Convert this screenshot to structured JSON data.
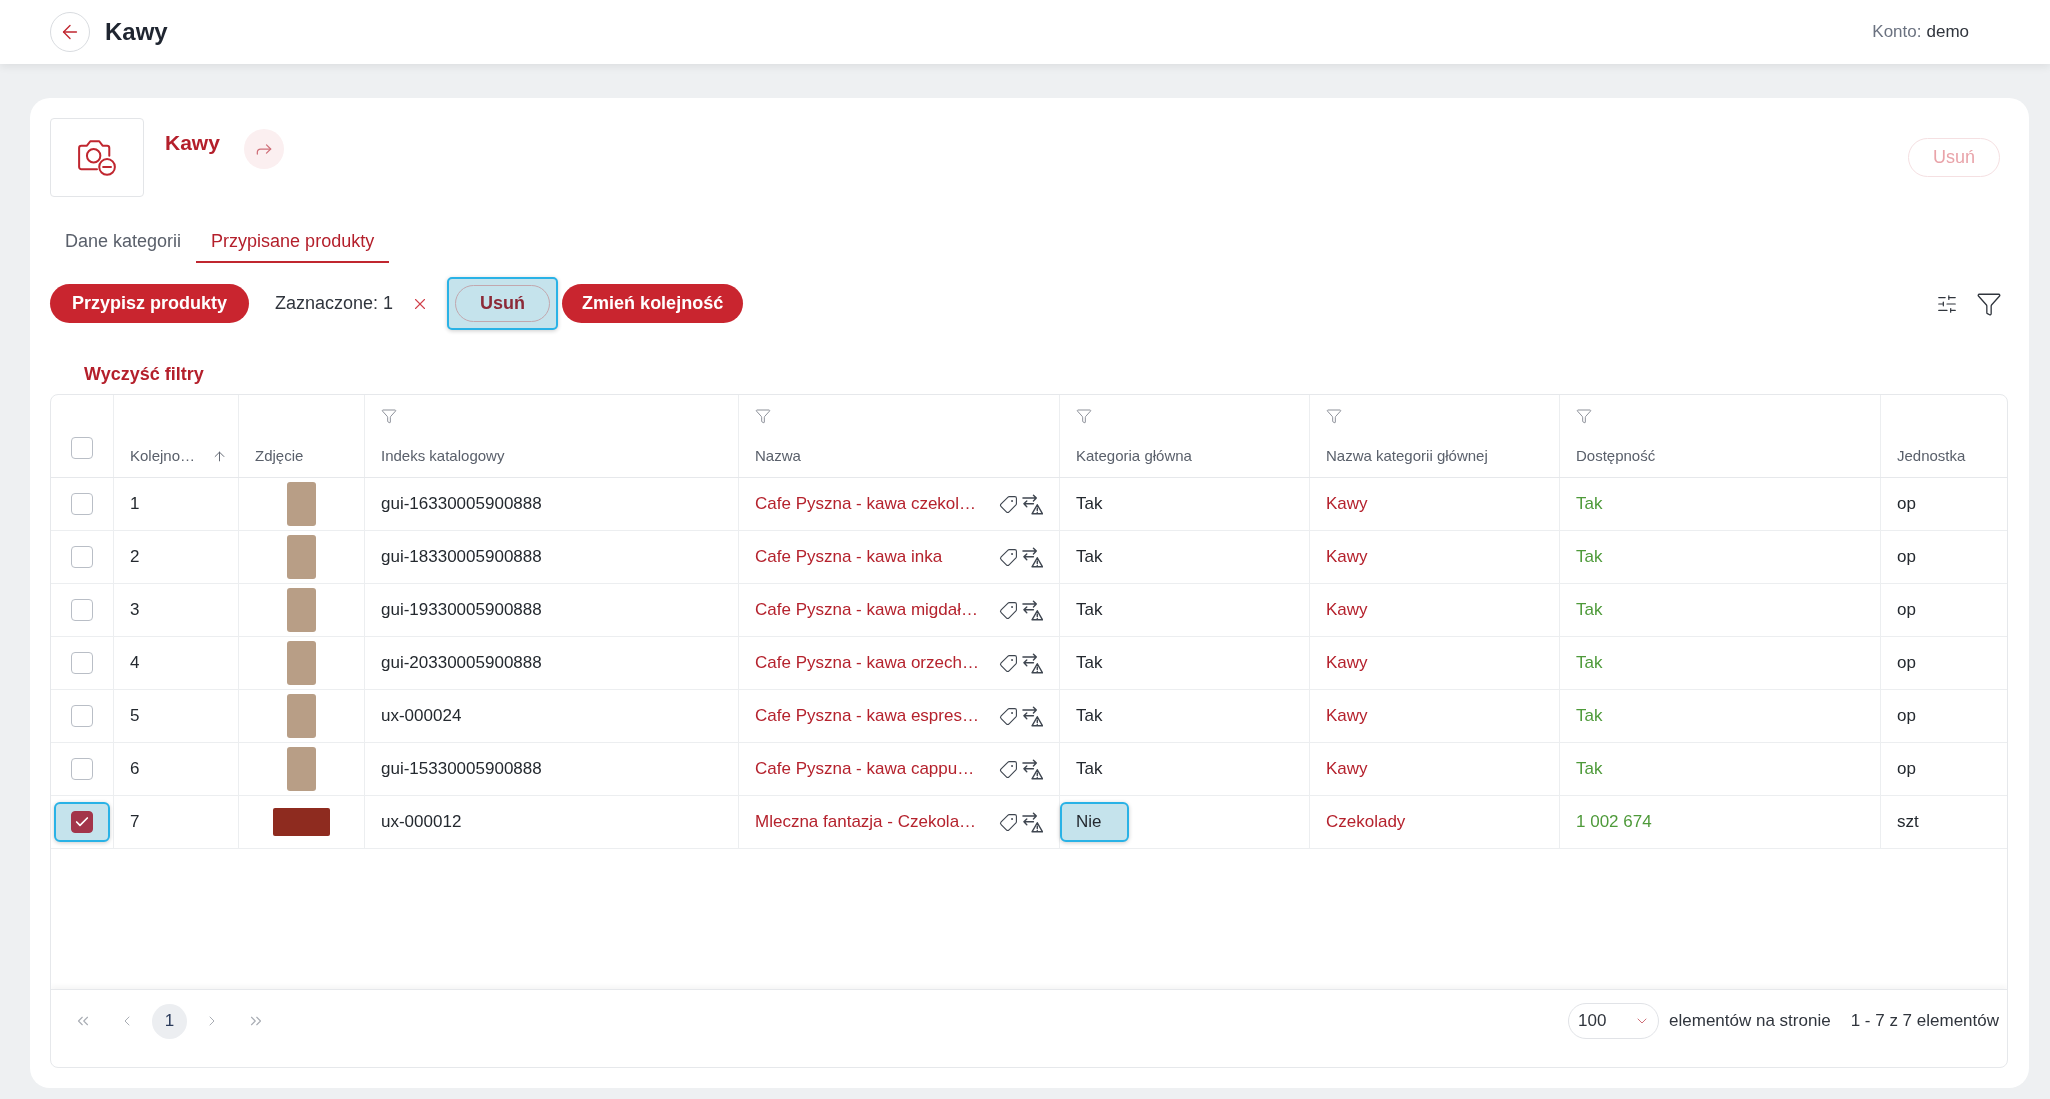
{
  "header": {
    "title": "Kawy",
    "account_label": "Konto:",
    "account_name": "demo"
  },
  "category": {
    "name": "Kawy",
    "delete_label": "Usuń",
    "delete_disabled": true
  },
  "tabs": [
    {
      "label": "Dane kategorii",
      "selected": false
    },
    {
      "label": "Przypisane produkty",
      "selected": true
    }
  ],
  "toolbar": {
    "assign_label": "Przypisz produkty",
    "selection_text": "Zaznaczone: 1",
    "remove_label": "Usuń",
    "remove_highlighted": true,
    "reorder_label": "Zmień kolejność"
  },
  "clear_filters": "Wyczyść filtry",
  "table": {
    "select_all_checked": false,
    "columns": [
      {
        "label": "Kolejno…",
        "filter": false,
        "sorted_ascending": true
      },
      {
        "label": "Zdjęcie",
        "filter": false,
        "sorted_ascending": false
      },
      {
        "label": "Indeks katalogowy",
        "filter": true,
        "sorted_ascending": false
      },
      {
        "label": "Nazwa",
        "filter": true,
        "sorted_ascending": false
      },
      {
        "label": "Kategoria główna",
        "filter": true,
        "sorted_ascending": false
      },
      {
        "label": "Nazwa kategorii głównej",
        "filter": true,
        "sorted_ascending": false
      },
      {
        "label": "Dostępność",
        "filter": true,
        "sorted_ascending": false
      },
      {
        "label": "Jednostka",
        "filter": false,
        "sorted_ascending": false
      }
    ],
    "rows": [
      {
        "checked": false,
        "checkbox_highlighted": false,
        "order": "1",
        "photo_wide": false,
        "index": "gui-16330005900888",
        "name": "Cafe Pyszna - kawa czekol…",
        "main_category": "Tak",
        "main_category_highlighted": false,
        "category_name": "Kawy",
        "availability": "Tak",
        "unit": "op"
      },
      {
        "checked": false,
        "checkbox_highlighted": false,
        "order": "2",
        "photo_wide": false,
        "index": "gui-18330005900888",
        "name": "Cafe Pyszna - kawa inka",
        "main_category": "Tak",
        "main_category_highlighted": false,
        "category_name": "Kawy",
        "availability": "Tak",
        "unit": "op"
      },
      {
        "checked": false,
        "checkbox_highlighted": false,
        "order": "3",
        "photo_wide": false,
        "index": "gui-19330005900888",
        "name": "Cafe Pyszna - kawa migdał…",
        "main_category": "Tak",
        "main_category_highlighted": false,
        "category_name": "Kawy",
        "availability": "Tak",
        "unit": "op"
      },
      {
        "checked": false,
        "checkbox_highlighted": false,
        "order": "4",
        "photo_wide": false,
        "index": "gui-20330005900888",
        "name": "Cafe Pyszna - kawa orzech…",
        "main_category": "Tak",
        "main_category_highlighted": false,
        "category_name": "Kawy",
        "availability": "Tak",
        "unit": "op"
      },
      {
        "checked": false,
        "checkbox_highlighted": false,
        "order": "5",
        "photo_wide": false,
        "index": "ux-000024",
        "name": "Cafe Pyszna - kawa espres…",
        "main_category": "Tak",
        "main_category_highlighted": false,
        "category_name": "Kawy",
        "availability": "Tak",
        "unit": "op"
      },
      {
        "checked": false,
        "checkbox_highlighted": false,
        "order": "6",
        "photo_wide": false,
        "index": "gui-15330005900888",
        "name": "Cafe Pyszna - kawa cappu…",
        "main_category": "Tak",
        "main_category_highlighted": false,
        "category_name": "Kawy",
        "availability": "Tak",
        "unit": "op"
      },
      {
        "checked": true,
        "checkbox_highlighted": true,
        "order": "7",
        "photo_wide": true,
        "index": "ux-000012",
        "name": "Mleczna fantazja - Czekola…",
        "main_category": "Nie",
        "main_category_highlighted": true,
        "category_name": "Czekolady",
        "availability": "1 002 674",
        "unit": "szt"
      }
    ]
  },
  "pagination": {
    "nav_disabled": true,
    "pages": [
      {
        "label": "1",
        "selected": true
      }
    ],
    "page_size": "100",
    "page_size_label": "elementów na stronie",
    "range": "1 - 7 z 7 elementów"
  }
}
